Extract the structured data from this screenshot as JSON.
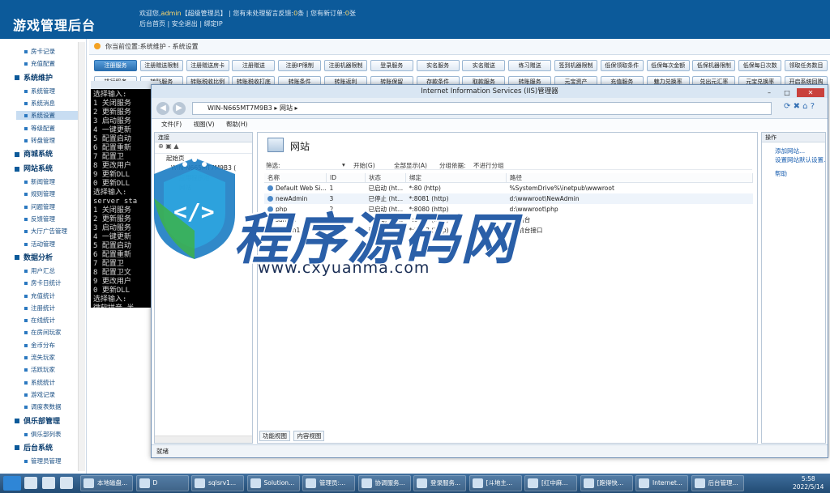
{
  "header": {
    "app_title": "游戏管理后台",
    "welcome_prefix": "欢迎您,",
    "user": "admin",
    "role": "【超级管理员】",
    "sep1": "|",
    "pending_feedback_prefix": "您有未处理留言反馈:",
    "pending_feedback_count": "0",
    "pending_feedback_suffix": "条",
    "sep2": "|",
    "pending_orders_prefix": "您有新订单:",
    "pending_orders_count": "0",
    "pending_orders_suffix": "张",
    "links": [
      "后台首页",
      "安全退出",
      "绑定IP"
    ]
  },
  "sidebar": {
    "items": [
      {
        "type": "item",
        "label": "房卡记录"
      },
      {
        "type": "item",
        "label": "充值配置"
      },
      {
        "type": "section",
        "label": "系统维护"
      },
      {
        "type": "item",
        "label": "系统管理"
      },
      {
        "type": "item",
        "label": "系统消息"
      },
      {
        "type": "item",
        "label": "系统设置",
        "active": true
      },
      {
        "type": "item",
        "label": "等级配置"
      },
      {
        "type": "item",
        "label": "转盘管理"
      },
      {
        "type": "section",
        "label": "商城系统"
      },
      {
        "type": "section",
        "label": "网站系统"
      },
      {
        "type": "item",
        "label": "新闻管理"
      },
      {
        "type": "item",
        "label": "规则管理"
      },
      {
        "type": "item",
        "label": "问题管理"
      },
      {
        "type": "item",
        "label": "反馈管理"
      },
      {
        "type": "item",
        "label": "大厅广告管理"
      },
      {
        "type": "item",
        "label": "活动管理"
      },
      {
        "type": "section",
        "label": "数据分析"
      },
      {
        "type": "item",
        "label": "用户汇总"
      },
      {
        "type": "item",
        "label": "房卡日统计"
      },
      {
        "type": "item",
        "label": "充值统计"
      },
      {
        "type": "item",
        "label": "注册统计"
      },
      {
        "type": "item",
        "label": "在线统计"
      },
      {
        "type": "item",
        "label": "在房间玩家"
      },
      {
        "type": "item",
        "label": "金币分布"
      },
      {
        "type": "item",
        "label": "流失玩家"
      },
      {
        "type": "item",
        "label": "活跃玩家"
      },
      {
        "type": "item",
        "label": "系统统计"
      },
      {
        "type": "item",
        "label": "游戏记录"
      },
      {
        "type": "item",
        "label": "调度表数据"
      },
      {
        "type": "section",
        "label": "俱乐部管理"
      },
      {
        "type": "item",
        "label": "俱乐部列表"
      },
      {
        "type": "section",
        "label": "后台系统"
      },
      {
        "type": "item",
        "label": "管理员管理"
      }
    ]
  },
  "breadcrumb": "你当前位置:系统维护 - 系统设置",
  "tabs_row1": [
    "注册服务",
    "注册赠送限制",
    "注册赠送房卡",
    "注册赠送",
    "注册IP限制",
    "注册机器限制",
    "登录服务",
    "实名服务",
    "实名赠送",
    "练习赠送",
    "签到机器限制",
    "低保领取条件",
    "低保每次金额",
    "低保机器限制",
    "低保每日次数",
    "领取任务数目"
  ],
  "tabs_row2": [
    "排行服务",
    "转账服务",
    "转账税收比例",
    "转账税收打底",
    "转账条件",
    "转账返利",
    "转账保留",
    "存款条件",
    "取款服务",
    "转账服务",
    "元宝资产",
    "充值服务",
    "魅力兑换率",
    "兑出元汇率",
    "元宝兑换率",
    "开启系统回购"
  ],
  "cmd": {
    "lines": [
      "选择输入:",
      "1 关闭服务",
      "2 更新服务",
      "3 启动服务",
      "4 一键更新",
      "5 配置启动",
      "6 配置重新",
      "7 配置卫",
      "8 更改用户",
      "9 更新DLL",
      "0 更新DLL",
      "选择输入:",
      "server sta",
      "1 关闭服务",
      "2 更新服务",
      "3 启动服务",
      "4 一键更新",
      "5 配置启动",
      "6 配置重新",
      "7 配置卫",
      "8 配置卫文",
      "9 更改用户",
      "0 更新DLL",
      "选择输入:",
      "",
      "",
      "微软拼音 半"
    ]
  },
  "iis": {
    "title": "Internet Information Services (IIS)管理器",
    "address": "WIN-N665MT7M9B3 ▸ 网站 ▸",
    "menu": [
      "文件(F)",
      "视图(V)",
      "帮助(H)"
    ],
    "connections_header": "连接",
    "tree": [
      "起始页",
      "WIN-N665MT7M9B3 (",
      "应用程序池",
      "网站"
    ],
    "page_title": "网站",
    "filter_label": "筛选:",
    "filter_start": "开始(G)",
    "filter_showall": "全部显示(A)",
    "filter_group_label": "分组依据:",
    "filter_group_value": "不进行分组",
    "columns": [
      "名称",
      "ID",
      "状态",
      "绑定",
      "路径"
    ],
    "rows": [
      [
        "Default Web Si...",
        "1",
        "已启动 (ht...",
        "*:80 (http)",
        "%SystemDrive%\\inetpub\\wwwroot"
      ],
      [
        "newAdmin",
        "3",
        "已停止 (ht...",
        "*:8081 (http)",
        "d:\\wwwroot\\NewAdmin"
      ],
      [
        "php",
        "2",
        "已启动 (ht...",
        "*:8080 (http)",
        "d:\\wwwroot\\php"
      ],
      [
        "sanren",
        "4",
        "已启动 (ht...",
        "*:8082 (http)",
        "D:\\后台"
      ],
      [
        "sanren1",
        "5",
        "已启动 (ht...",
        "*:8083 (http)",
        "D:\\前台接口"
      ]
    ],
    "view_tabs": [
      "功能视图",
      "内容视图"
    ],
    "actions_header": "操作",
    "actions": [
      "添加网站...",
      "设置网站默认设置...",
      "帮助"
    ],
    "status": "就绪"
  },
  "watermark": {
    "text": "程序源码网",
    "url": "www.cxyuanma.com"
  },
  "taskbar": {
    "items": [
      "本地磁盘...",
      "D",
      "sqlsrv1...",
      "Solution...",
      "管理员:...",
      "协调服务...",
      "登录服务...",
      "[斗地主...",
      "[红中麻...",
      "[跑得快...",
      "Internet...",
      "后台管理..."
    ],
    "time": "5:58",
    "date": "2022/5/14"
  },
  "colors": {
    "header_bg": "#0c5a9a",
    "tab_active": "#2a6fb0",
    "taskbar": "#224b73"
  }
}
